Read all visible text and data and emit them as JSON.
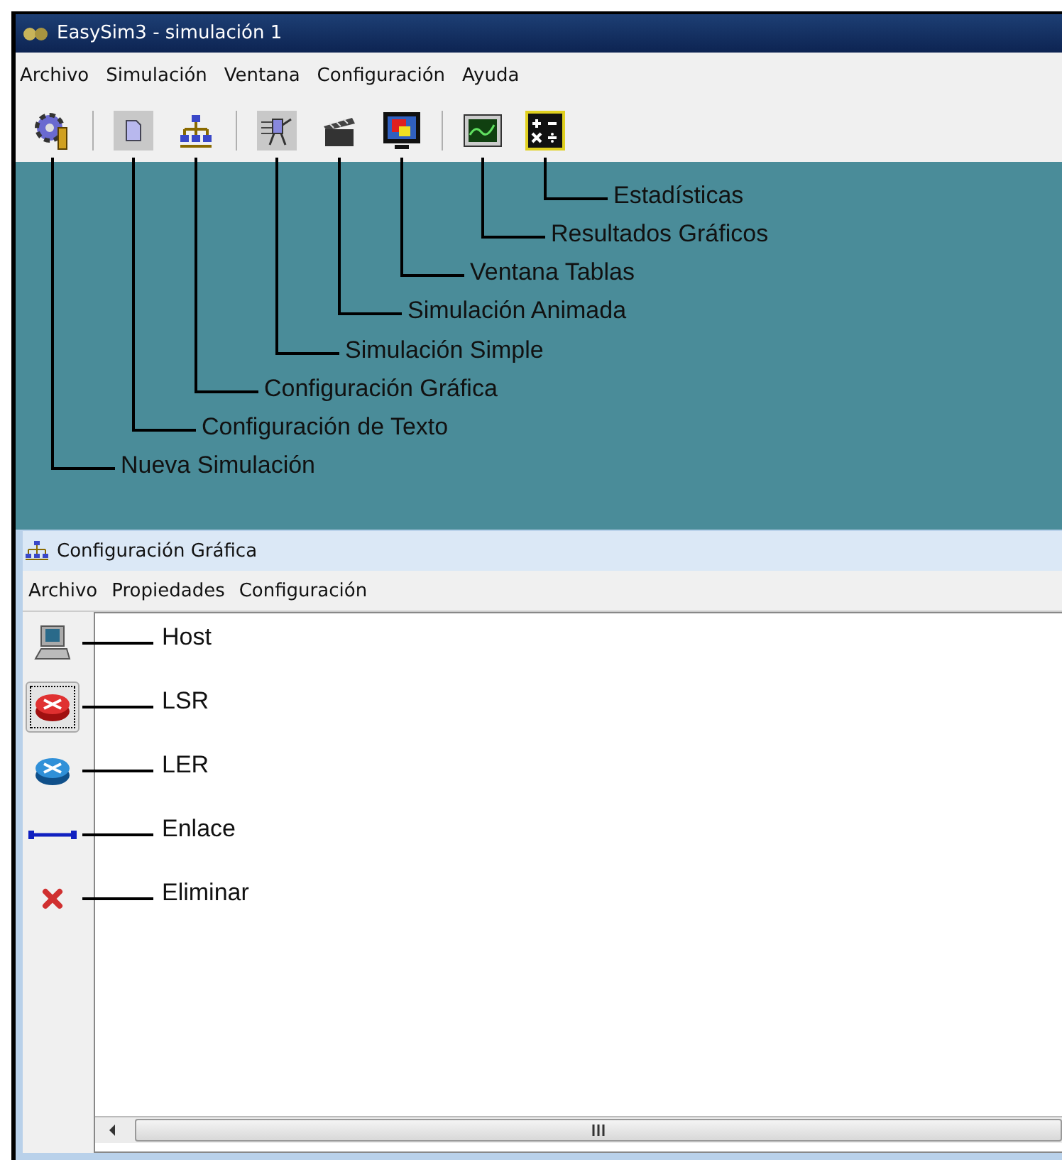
{
  "window": {
    "title": "EasySim3 - simulación 1"
  },
  "menu": [
    "Archivo",
    "Simulación",
    "Ventana",
    "Configuración",
    "Ayuda"
  ],
  "toolbar_groups": [
    [
      {
        "kind": "gear"
      }
    ],
    [
      {
        "kind": "document"
      },
      {
        "kind": "hierarchy"
      }
    ],
    [
      {
        "kind": "simulation"
      },
      {
        "kind": "clapper"
      },
      {
        "kind": "monitor"
      }
    ],
    [
      {
        "kind": "chart"
      },
      {
        "kind": "calculator"
      }
    ]
  ],
  "toolbar_callouts": [
    "Estadísticas",
    "Resultados Gráficos",
    "Ventana Tablas",
    "Simulación Animada",
    "Simulación Simple",
    "Configuración Gráfica",
    "Configuración de Texto",
    "Nueva Simulación"
  ],
  "child_window": {
    "title": "Configuración Gráfica",
    "menu": [
      "Archivo",
      "Propiedades",
      "Configuración"
    ],
    "tools": [
      {
        "kind": "host",
        "callout": "Host",
        "selected": false
      },
      {
        "kind": "lsr",
        "callout": "LSR",
        "selected": true
      },
      {
        "kind": "ler",
        "callout": "LER",
        "selected": false
      },
      {
        "kind": "link",
        "callout": "Enlace",
        "selected": false
      },
      {
        "kind": "delete",
        "callout": "Eliminar",
        "selected": false
      }
    ]
  }
}
